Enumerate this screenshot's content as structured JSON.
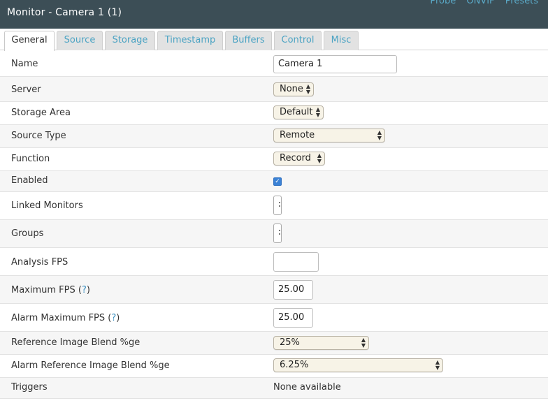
{
  "header": {
    "title": "Monitor - Camera 1 (1)",
    "links": [
      "Probe",
      "ONVIF",
      "Presets"
    ]
  },
  "tabs": [
    "General",
    "Source",
    "Storage",
    "Timestamp",
    "Buffers",
    "Control",
    "Misc"
  ],
  "active_tab": "General",
  "fields": {
    "name": {
      "label": "Name",
      "value": "Camera 1"
    },
    "server": {
      "label": "Server",
      "value": "None"
    },
    "storage_area": {
      "label": "Storage Area",
      "value": "Default"
    },
    "source_type": {
      "label": "Source Type",
      "value": "Remote"
    },
    "function": {
      "label": "Function",
      "value": "Record"
    },
    "enabled": {
      "label": "Enabled",
      "checked": true
    },
    "linked_monitors": {
      "label": "Linked Monitors"
    },
    "groups": {
      "label": "Groups"
    },
    "analysis_fps": {
      "label": "Analysis FPS",
      "value": ""
    },
    "maximum_fps": {
      "label": "Maximum FPS",
      "help": "?",
      "value": "25.00"
    },
    "alarm_maximum_fps": {
      "label": "Alarm Maximum FPS",
      "help": "?",
      "value": "25.00"
    },
    "ref_blend": {
      "label": "Reference Image Blend %ge",
      "value": "25%"
    },
    "alarm_ref_blend": {
      "label": "Alarm Reference Image Blend %ge",
      "value": "6.25%"
    },
    "triggers": {
      "label": "Triggers",
      "value": "None available"
    }
  },
  "colors": {
    "header_bg": "#3c4e56",
    "link": "#5aa9c7",
    "checkbox": "#3b82d6"
  }
}
